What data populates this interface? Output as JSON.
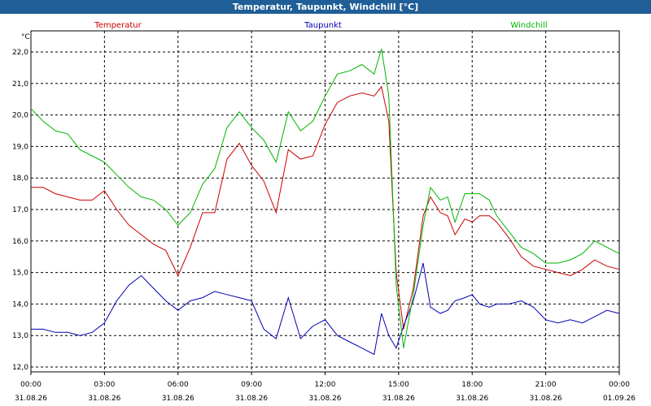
{
  "window": {
    "title": "Temperatur, Taupunkt, Windchill [°C]"
  },
  "chart_data": {
    "type": "line",
    "title": "Temperatur, Taupunkt, Windchill [°C]",
    "ylabel": "°C",
    "ylim": [
      11.8,
      22.6
    ],
    "y_ticks": [
      "12,0",
      "13,0",
      "14,0",
      "15,0",
      "16,0",
      "17,0",
      "18,0",
      "19,0",
      "20,0",
      "21,0",
      "22,0"
    ],
    "x_ticks": [
      {
        "time": "00:00",
        "date": "31.08.26"
      },
      {
        "time": "03:00",
        "date": "31.08.26"
      },
      {
        "time": "06:00",
        "date": "31.08.26"
      },
      {
        "time": "09:00",
        "date": "31.08.26"
      },
      {
        "time": "12:00",
        "date": "31.08.26"
      },
      {
        "time": "15:00",
        "date": "31.08.26"
      },
      {
        "time": "18:00",
        "date": "31.08.26"
      },
      {
        "time": "21:00",
        "date": "31.08.26"
      },
      {
        "time": "00:00",
        "date": "01.09.26"
      }
    ],
    "xlim_hours": [
      0,
      24
    ],
    "grid": true,
    "legend_position": "top",
    "series": [
      {
        "name": "Temperatur",
        "color": "#cc0000",
        "points": [
          [
            0,
            17.7
          ],
          [
            0.5,
            17.7
          ],
          [
            1,
            17.5
          ],
          [
            1.5,
            17.4
          ],
          [
            2,
            17.3
          ],
          [
            2.5,
            17.3
          ],
          [
            3,
            17.6
          ],
          [
            3.5,
            17.0
          ],
          [
            4,
            16.5
          ],
          [
            4.5,
            16.2
          ],
          [
            5,
            15.9
          ],
          [
            5.5,
            15.7
          ],
          [
            6,
            14.9
          ],
          [
            6.5,
            15.8
          ],
          [
            7,
            16.9
          ],
          [
            7.5,
            16.9
          ],
          [
            8,
            18.6
          ],
          [
            8.5,
            19.1
          ],
          [
            9,
            18.4
          ],
          [
            9.5,
            17.9
          ],
          [
            10,
            16.9
          ],
          [
            10.5,
            18.9
          ],
          [
            11,
            18.6
          ],
          [
            11.5,
            18.7
          ],
          [
            12,
            19.7
          ],
          [
            12.5,
            20.4
          ],
          [
            13,
            20.6
          ],
          [
            13.5,
            20.7
          ],
          [
            14,
            20.6
          ],
          [
            14.3,
            20.9
          ],
          [
            14.6,
            19.8
          ],
          [
            14.9,
            15.0
          ],
          [
            15.2,
            13.2
          ],
          [
            15.6,
            14.5
          ],
          [
            16,
            16.8
          ],
          [
            16.3,
            17.4
          ],
          [
            16.7,
            16.9
          ],
          [
            17,
            16.8
          ],
          [
            17.3,
            16.2
          ],
          [
            17.7,
            16.7
          ],
          [
            18,
            16.6
          ],
          [
            18.3,
            16.8
          ],
          [
            18.7,
            16.8
          ],
          [
            19,
            16.6
          ],
          [
            19.5,
            16.1
          ],
          [
            20,
            15.5
          ],
          [
            20.5,
            15.2
          ],
          [
            21,
            15.1
          ],
          [
            21.5,
            15.0
          ],
          [
            22,
            14.9
          ],
          [
            22.5,
            15.1
          ],
          [
            23,
            15.4
          ],
          [
            23.5,
            15.2
          ],
          [
            24,
            15.1
          ]
        ]
      },
      {
        "name": "Taupunkt",
        "color": "#0000b4",
        "points": [
          [
            0,
            13.2
          ],
          [
            0.5,
            13.2
          ],
          [
            1,
            13.1
          ],
          [
            1.5,
            13.1
          ],
          [
            2,
            13.0
          ],
          [
            2.5,
            13.1
          ],
          [
            3,
            13.4
          ],
          [
            3.5,
            14.1
          ],
          [
            4,
            14.6
          ],
          [
            4.5,
            14.9
          ],
          [
            5,
            14.5
          ],
          [
            5.5,
            14.1
          ],
          [
            6,
            13.8
          ],
          [
            6.5,
            14.1
          ],
          [
            7,
            14.2
          ],
          [
            7.5,
            14.4
          ],
          [
            8,
            14.3
          ],
          [
            8.5,
            14.2
          ],
          [
            9,
            14.1
          ],
          [
            9.5,
            13.2
          ],
          [
            10,
            12.9
          ],
          [
            10.5,
            14.2
          ],
          [
            11,
            12.9
          ],
          [
            11.5,
            13.3
          ],
          [
            12,
            13.5
          ],
          [
            12.5,
            13.0
          ],
          [
            13,
            12.8
          ],
          [
            13.5,
            12.6
          ],
          [
            14,
            12.4
          ],
          [
            14.3,
            13.7
          ],
          [
            14.6,
            13.0
          ],
          [
            14.9,
            12.6
          ],
          [
            15.2,
            13.3
          ],
          [
            15.6,
            14.1
          ],
          [
            16,
            15.3
          ],
          [
            16.3,
            13.9
          ],
          [
            16.7,
            13.7
          ],
          [
            17,
            13.8
          ],
          [
            17.3,
            14.1
          ],
          [
            17.7,
            14.2
          ],
          [
            18,
            14.3
          ],
          [
            18.3,
            14.0
          ],
          [
            18.7,
            13.9
          ],
          [
            19,
            14.0
          ],
          [
            19.5,
            14.0
          ],
          [
            20,
            14.1
          ],
          [
            20.5,
            13.9
          ],
          [
            21,
            13.5
          ],
          [
            21.5,
            13.4
          ],
          [
            22,
            13.5
          ],
          [
            22.5,
            13.4
          ],
          [
            23,
            13.6
          ],
          [
            23.5,
            13.8
          ],
          [
            24,
            13.7
          ]
        ]
      },
      {
        "name": "Windchill",
        "color": "#00b400",
        "points": [
          [
            0,
            20.2
          ],
          [
            0.5,
            19.8
          ],
          [
            1,
            19.5
          ],
          [
            1.5,
            19.4
          ],
          [
            2,
            18.9
          ],
          [
            2.5,
            18.7
          ],
          [
            3,
            18.5
          ],
          [
            3.5,
            18.1
          ],
          [
            4,
            17.7
          ],
          [
            4.5,
            17.4
          ],
          [
            5,
            17.3
          ],
          [
            5.5,
            17.0
          ],
          [
            6,
            16.5
          ],
          [
            6.5,
            16.9
          ],
          [
            7,
            17.8
          ],
          [
            7.5,
            18.3
          ],
          [
            8,
            19.6
          ],
          [
            8.5,
            20.1
          ],
          [
            9,
            19.6
          ],
          [
            9.5,
            19.2
          ],
          [
            10,
            18.5
          ],
          [
            10.5,
            20.1
          ],
          [
            11,
            19.5
          ],
          [
            11.5,
            19.8
          ],
          [
            12,
            20.6
          ],
          [
            12.5,
            21.3
          ],
          [
            13,
            21.4
          ],
          [
            13.5,
            21.6
          ],
          [
            14,
            21.3
          ],
          [
            14.3,
            22.1
          ],
          [
            14.6,
            20.6
          ],
          [
            14.9,
            14.6
          ],
          [
            15.2,
            12.6
          ],
          [
            15.6,
            14.3
          ],
          [
            16,
            16.5
          ],
          [
            16.3,
            17.7
          ],
          [
            16.7,
            17.3
          ],
          [
            17,
            17.4
          ],
          [
            17.3,
            16.6
          ],
          [
            17.7,
            17.5
          ],
          [
            18,
            17.5
          ],
          [
            18.3,
            17.5
          ],
          [
            18.7,
            17.3
          ],
          [
            19,
            16.8
          ],
          [
            19.5,
            16.3
          ],
          [
            20,
            15.8
          ],
          [
            20.5,
            15.6
          ],
          [
            21,
            15.3
          ],
          [
            21.5,
            15.3
          ],
          [
            22,
            15.4
          ],
          [
            22.5,
            15.6
          ],
          [
            23,
            16.0
          ],
          [
            23.5,
            15.8
          ],
          [
            24,
            15.6
          ]
        ]
      }
    ]
  }
}
